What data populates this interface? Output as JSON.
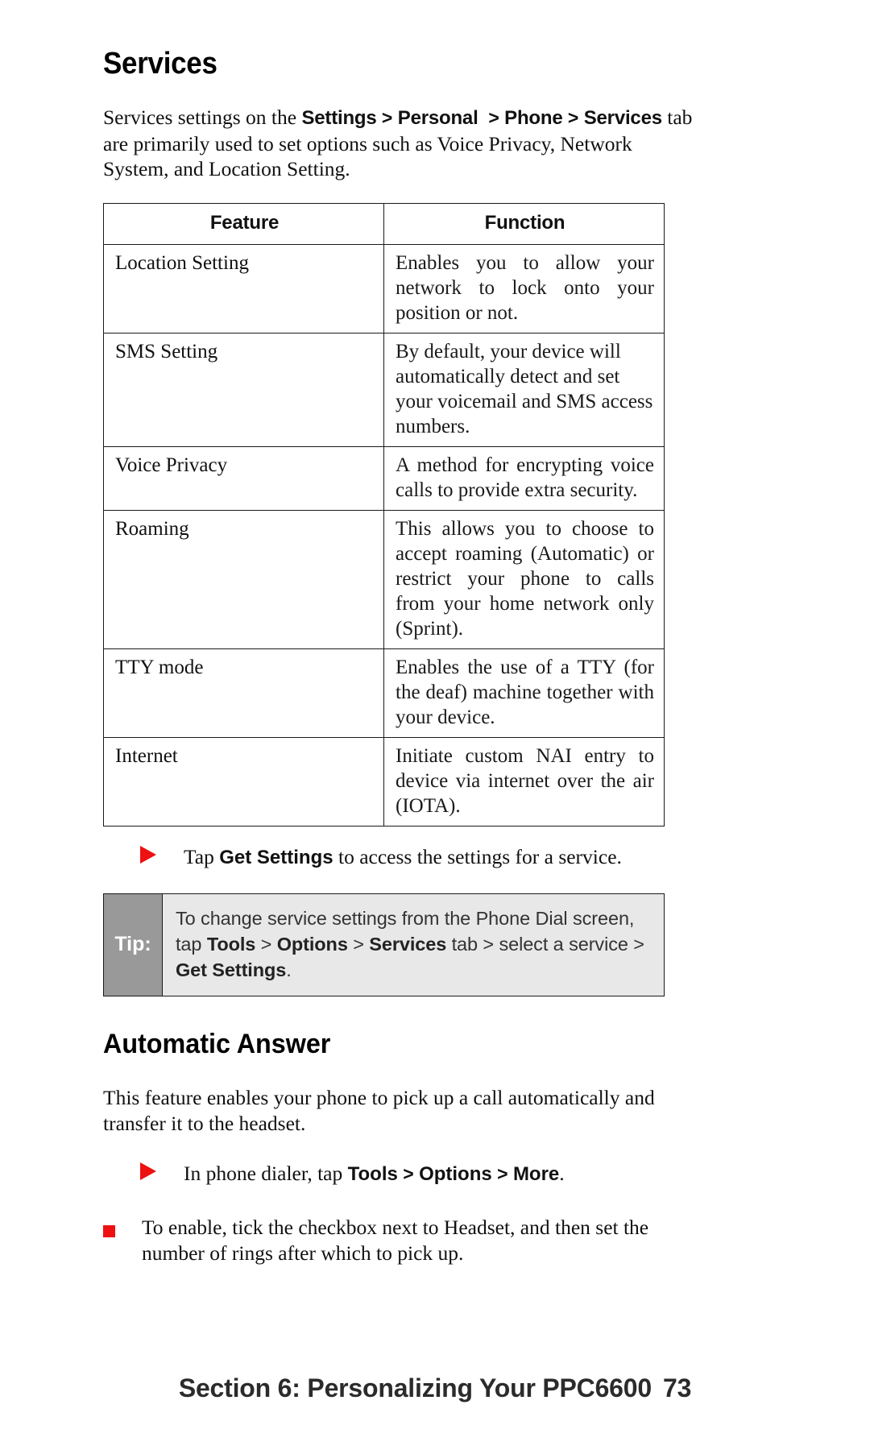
{
  "page": {
    "heading": "Services",
    "subheading": "Automatic Answer",
    "footer_text": "Section 6: Personalizing Your PPC6600",
    "page_number": "73",
    "accent_red": "#ee1111",
    "tip_label_bg": "#999999",
    "tip_body_bg": "#e8e8e8"
  },
  "intro": {
    "lead": "Services settings on the ",
    "path_1": "Settings",
    "sep_1": ">",
    "path_2": "Personal",
    "sep_2": ">",
    "path_3": "Phone",
    "sep_3": ">",
    "path_4": "Services",
    "tail": " tab are primarily used to set options such as Voice Privacy, Network System, and Location Setting."
  },
  "table": {
    "headers": [
      "Feature",
      "Function"
    ],
    "rows": [
      {
        "feature": "Location Setting",
        "function": "Enables you to allow your network to lock onto your position or not."
      },
      {
        "feature": "SMS Setting",
        "function": "By default, your device will automatically detect and set your voicemail and SMS access numbers."
      },
      {
        "feature": "Voice Privacy",
        "function": "A method for encrypting voice calls to provide extra security."
      },
      {
        "feature": "Roaming",
        "function": "This allows you to choose to accept roaming (Automatic) or restrict your phone to calls from your home network only (Sprint)."
      },
      {
        "feature": "TTY mode",
        "function": "Enables the use of a TTY (for the deaf) machine together with your device."
      },
      {
        "feature": "Internet",
        "function": "Initiate custom NAI entry to device via internet over the air (IOTA)."
      }
    ]
  },
  "bullet_get_settings": {
    "pre": "Tap ",
    "bold": "Get Settings",
    "post": " to access the settings for a service."
  },
  "tip": {
    "label": "Tip:",
    "line1_pre": "To change service settings from the Phone Dial screen, tap ",
    "line1_bold": "Tools",
    "line1_sep": " > ",
    "line2_bold1": "Options",
    "line2_sep1": " > ",
    "line2_bold2": "Services",
    "line2_mid": " tab > select a service > ",
    "line2_bold3": "Get Settings",
    "line2_end": "."
  },
  "automatic_answer": {
    "paragraph": "This feature enables your phone to pick up a call automatically and transfer it to the headset.",
    "bullet_dialer": {
      "pre": "In phone dialer, tap ",
      "bold1": "Tools",
      "sep1": " > ",
      "bold2": "Options",
      "sep2": " > ",
      "bold3": "More",
      "post": "."
    },
    "bullet_enable": "To enable, tick the checkbox next to Headset, and then set the number of rings after which to pick up."
  }
}
